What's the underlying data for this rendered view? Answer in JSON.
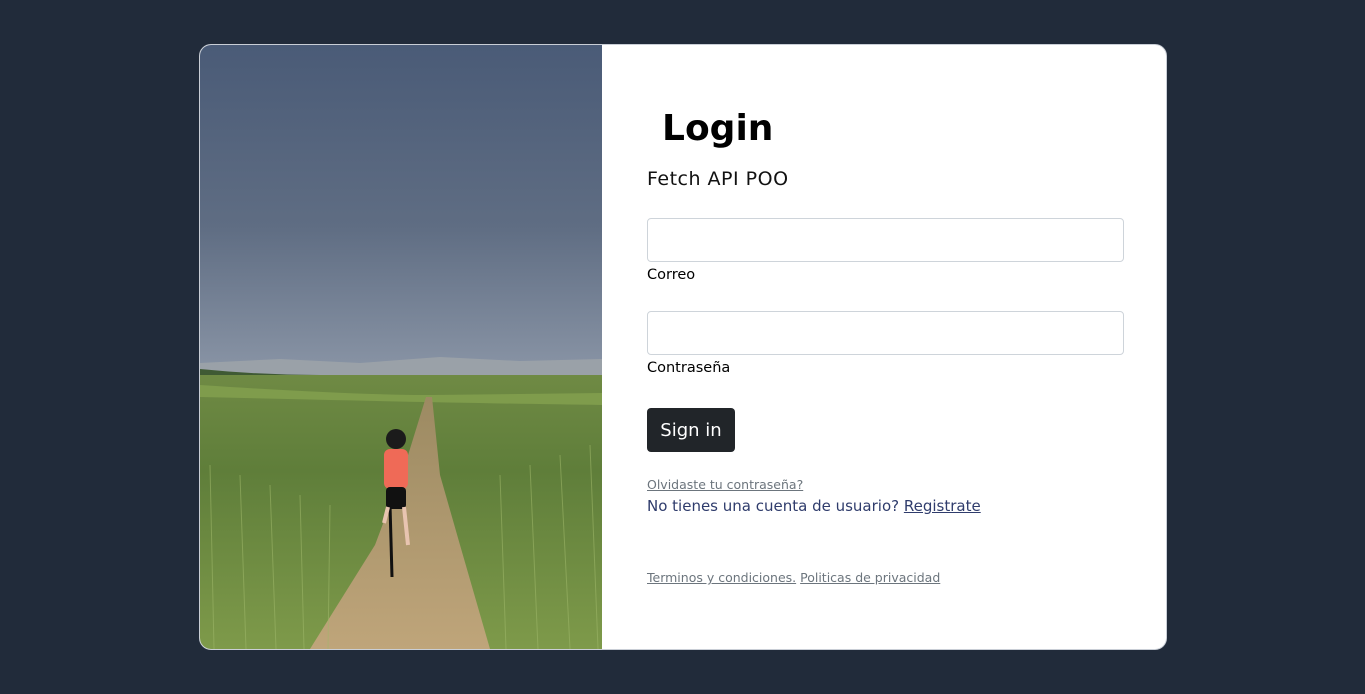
{
  "login": {
    "title": "Login",
    "subtitle": "Fetch API POO",
    "email_label": "Correo",
    "email_value": "",
    "password_label": "Contraseña",
    "password_value": "",
    "signin_label": "Sign in",
    "forgot_label": "Olvidaste tu contraseña?",
    "no_account_text": "No tienes una cuenta de usuario?",
    "register_label": "Registrate",
    "terms_label": "Terminos y condiciones.",
    "privacy_label": "Politicas de privacidad"
  },
  "colors": {
    "page_background": "#212b3a",
    "card_background": "#ffffff",
    "button_background": "#212529",
    "link_accent": "#2f3c6c",
    "muted_link": "#6c757d"
  },
  "image": {
    "subject": "cyclist-in-wheat-field-photo"
  }
}
